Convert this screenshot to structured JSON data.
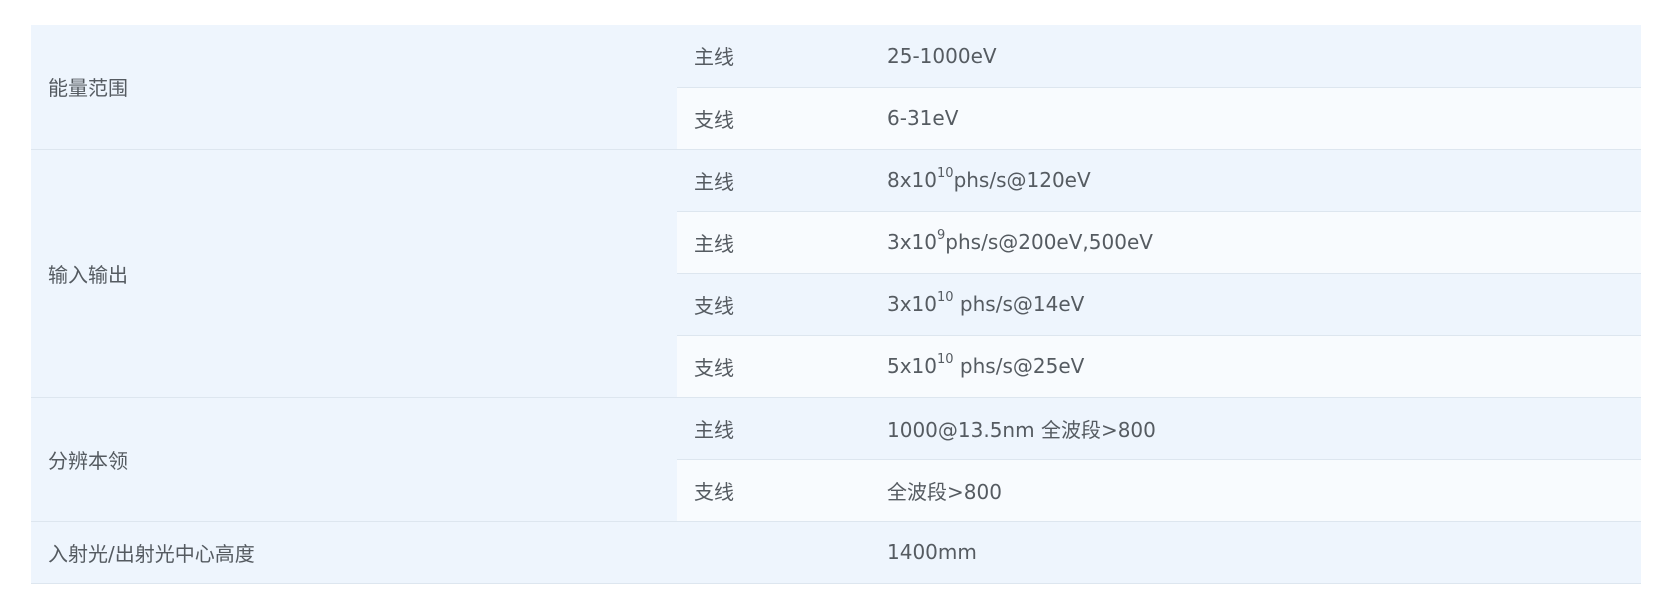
{
  "table": {
    "energy_range": {
      "label": "能量范围",
      "rows": [
        {
          "line": "主线",
          "value": "25-1000eV"
        },
        {
          "line": "支线",
          "value": "6-31eV"
        }
      ]
    },
    "flux": {
      "label": "输入输出",
      "rows": [
        {
          "line": "主线",
          "base": "8x10",
          "exp": "10",
          "rest": "phs/s@120eV"
        },
        {
          "line": "主线",
          "base": "3x10",
          "exp": "9",
          "rest": "phs/s@200eV,500eV"
        },
        {
          "line": "支线",
          "base": "3x10",
          "exp": "10",
          "rest": " phs/s@14eV"
        },
        {
          "line": "支线",
          "base": "5x10",
          "exp": "10",
          "rest": " phs/s@25eV"
        }
      ]
    },
    "resolution": {
      "label": "分辨本领",
      "rows": [
        {
          "line": "主线",
          "value": "1000@13.5nm 全波段>800"
        },
        {
          "line": "支线",
          "value": "全波段>800"
        }
      ]
    },
    "height": {
      "label": "入射光/出射光中心高度",
      "value": "1400mm"
    }
  }
}
